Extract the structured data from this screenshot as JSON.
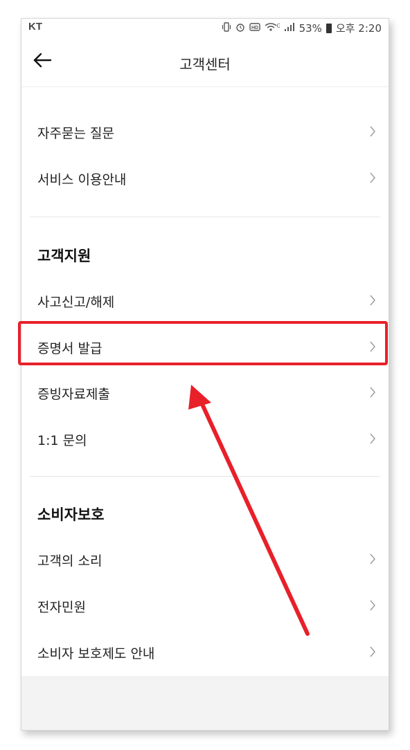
{
  "status_bar": {
    "carrier": "KT",
    "icons": [
      "vibrate-icon",
      "alarm-icon",
      "hd-icon",
      "wifi-icon",
      "signal-icon"
    ],
    "wifi_label": "G",
    "battery": "53%",
    "time": "오후 2:20"
  },
  "header": {
    "title": "고객센터",
    "back_icon": "arrow-left-icon"
  },
  "groups": [
    {
      "heading": "",
      "items": [
        {
          "label": "자주묻는 질문"
        },
        {
          "label": "서비스 이용안내"
        }
      ]
    },
    {
      "heading": "고객지원",
      "items": [
        {
          "label": "사고신고/해제"
        },
        {
          "label": "증명서 발급",
          "highlighted": true
        },
        {
          "label": "증빙자료제출"
        },
        {
          "label": "1:1 문의"
        }
      ]
    },
    {
      "heading": "소비자보호",
      "items": [
        {
          "label": "고객의 소리"
        },
        {
          "label": "전자민원"
        },
        {
          "label": "소비자 보호제도 안내"
        }
      ]
    }
  ],
  "annotation": {
    "highlight_color": "#e8202a"
  }
}
